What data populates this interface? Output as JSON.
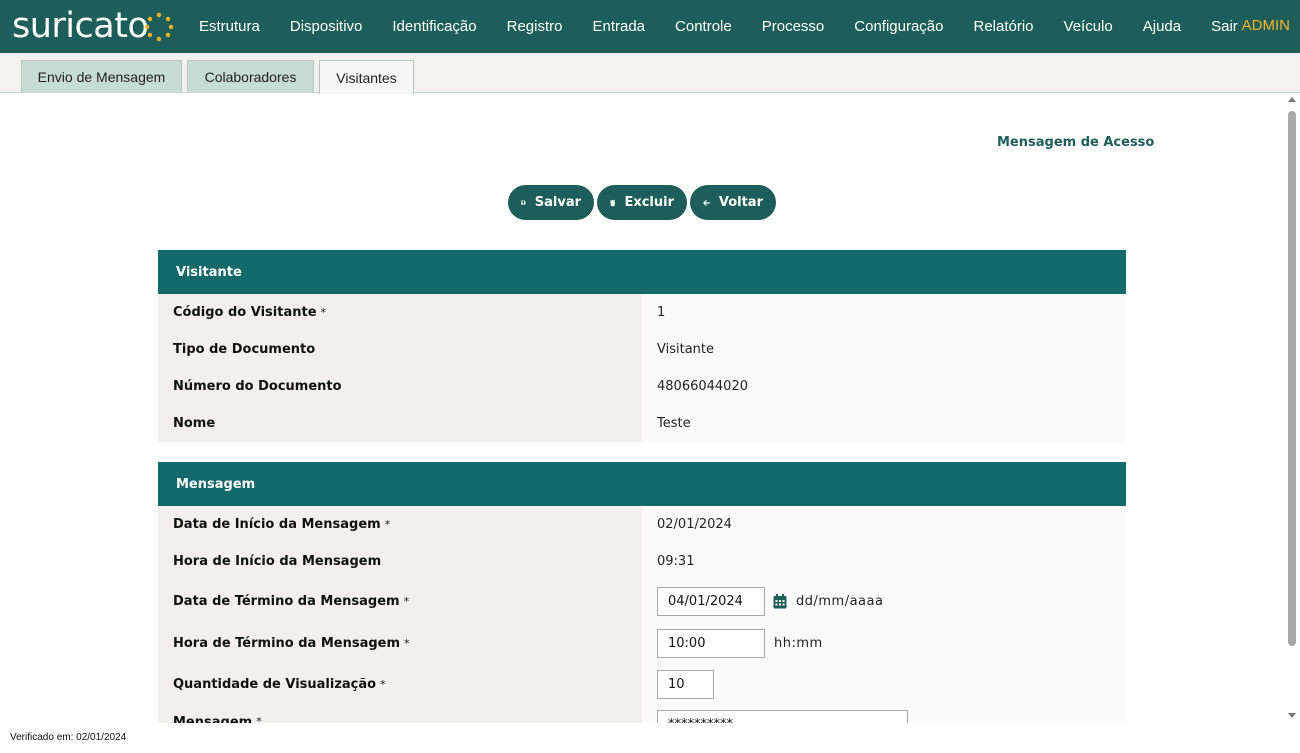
{
  "app": {
    "logo_text": "suricato",
    "user": "ADMIN"
  },
  "nav": [
    "Estrutura",
    "Dispositivo",
    "Identificação",
    "Registro",
    "Entrada",
    "Controle",
    "Processo",
    "Configuração",
    "Relatório",
    "Veículo",
    "Ajuda",
    "Sair"
  ],
  "tabs": [
    "Envio de Mensagem",
    "Colaboradores",
    "Visitantes"
  ],
  "page": {
    "title": "Mensagem de Acesso"
  },
  "actions": {
    "save": "Salvar",
    "delete": "Excluir",
    "back": "Voltar"
  },
  "visitor": {
    "heading": "Visitante",
    "rows": [
      {
        "label": "Código do Visitante",
        "required": "*",
        "value": "1"
      },
      {
        "label": "Tipo de Documento",
        "value": "Visitante"
      },
      {
        "label": "Número do Documento",
        "value": "48066044020"
      },
      {
        "label": "Nome",
        "value": "Teste"
      }
    ]
  },
  "message": {
    "heading": "Mensagem",
    "start_date": {
      "label": "Data de Início da Mensagem",
      "required": "*",
      "value": "02/01/2024"
    },
    "start_time": {
      "label": "Hora de Início da Mensagem",
      "value": "09:31"
    },
    "end_date": {
      "label": "Data de Término da Mensagem",
      "required": "*",
      "value": "04/01/2024",
      "hint": "dd/mm/aaaa"
    },
    "end_time": {
      "label": "Hora de Término da Mensagem",
      "required": "*",
      "value": "10:00",
      "hint": "hh:mm"
    },
    "views": {
      "label": "Quantidade de Visualização",
      "required": "*",
      "value": "10"
    },
    "text": {
      "label": "Mensagem",
      "required": "*",
      "value": "**********"
    }
  },
  "footer": {
    "verified": "Verificado em: 02/01/2024"
  },
  "colors": {
    "primary": "#1d5e5a",
    "section_header": "#14696a",
    "accent": "#f5b326",
    "tab_inactive": "#c8dcd6"
  }
}
